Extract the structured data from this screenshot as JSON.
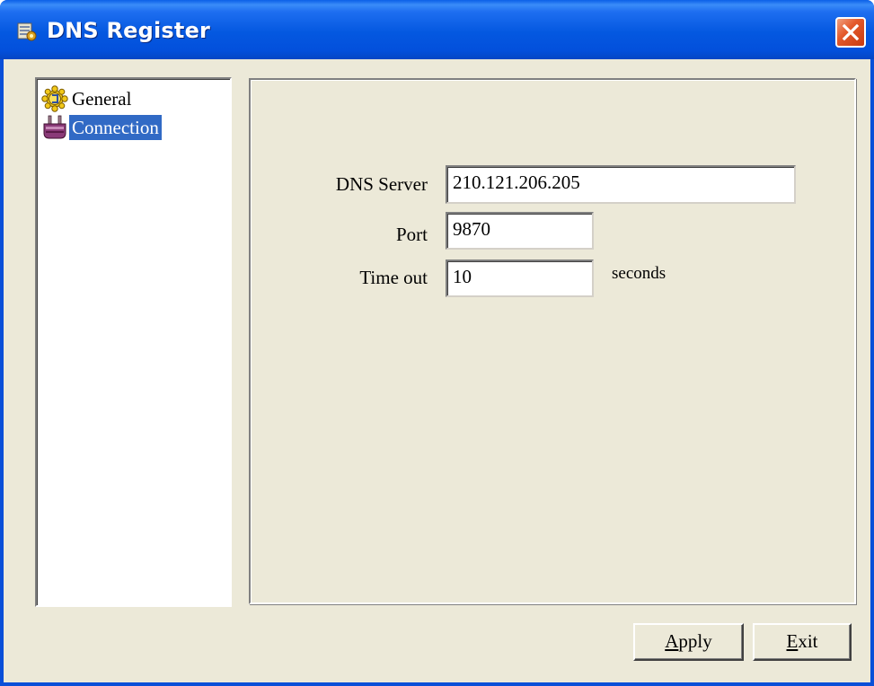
{
  "window": {
    "title": "DNS Register",
    "colors": {
      "titlebar": "#0458e0",
      "face": "#ece9d8",
      "selection": "#316ac5",
      "close": "#e45a2c"
    },
    "icons": {
      "app": "dns-register-app-icon",
      "close": "close-icon"
    }
  },
  "tree": {
    "items": [
      {
        "label": "General",
        "icon": "general-gear-icon",
        "selected": false
      },
      {
        "label": "Connection",
        "icon": "connection-plug-icon",
        "selected": true
      }
    ]
  },
  "connection": {
    "dns_server": {
      "label": "DNS Server",
      "value": "210.121.206.205"
    },
    "port": {
      "label": "Port",
      "value": "9870"
    },
    "timeout": {
      "label": "Time out",
      "value": "10",
      "unit": "seconds"
    }
  },
  "buttons": {
    "apply": {
      "label": "Apply",
      "mnemonic": "A",
      "rest": "pply"
    },
    "exit": {
      "label": "Exit",
      "mnemonic": "E",
      "rest": "xit"
    }
  }
}
